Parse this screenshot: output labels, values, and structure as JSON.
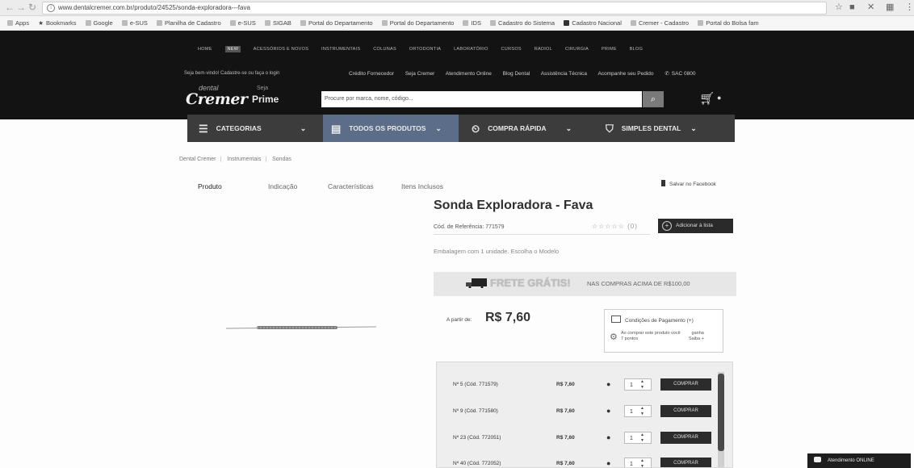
{
  "browser": {
    "url": "www.dentalcremer.com.br/produto/24525/sonda-exploradora---fava",
    "back_icon": "back-arrow-icon",
    "forward_icon": "forward-arrow-icon",
    "reload_icon": "reload-icon",
    "bookmarks": [
      "Apps",
      "Bookmarks",
      "Google",
      "e-SUS",
      "Planilha de Cadastro",
      "e-SUS",
      "SIGAB",
      "Portal do Departamento",
      "Portal do Departamento",
      "IDS",
      "Cadastro do Sistema",
      "Cadastro Nacional",
      "Cremer - Cadastro",
      "Portal do Bolsa fam"
    ]
  },
  "header": {
    "top_links": [
      "HOME",
      "NEW",
      "ACESSÓRIOS E NOVOS",
      "INSTRUMENTAIS",
      "COLUNAS",
      "ORTODONTIA",
      "LABORATÓRIO",
      "CURSOS",
      "RADIOL",
      "CIRURGIA",
      "PRIME",
      "BLOG"
    ],
    "welcome": "Seja bem-vindo! Cadastre-se ou faça o login",
    "links": [
      "Crédito Fornecedor",
      "Seja Cremer",
      "Atendimento Online",
      "Blog Dental",
      "Assistência Técnica",
      "Acompanhe seu Pedido",
      "SAC 0800"
    ],
    "logo_small": "dental",
    "logo": "Cremer",
    "prime_top": "Seja",
    "prime": "Prime",
    "search_placeholder": "Procure por marca, nome, código..."
  },
  "navbar": {
    "categories": "CATEGORIAS",
    "all_products": "TODOS OS PRODUTOS",
    "quick_buy": "COMPRA RÁPIDA",
    "simples": "SIMPLES DENTAL"
  },
  "breadcrumb": [
    "Dental Cremer",
    "Instrumentais",
    "Sondas"
  ],
  "tabs": [
    "Produto",
    "Indicação",
    "Características",
    "Itens Inclusos"
  ],
  "facebook_save": "Salvar no Facebook",
  "product": {
    "title": "Sonda Exploradora - Fava",
    "ref": "Cód. de Referência: 771579",
    "rating_stars": "☆☆☆☆☆",
    "rating_value": 0,
    "rating_count": "(0)",
    "add_list": "Adicionar à lista",
    "description": "Embalagem com 1 unidade. Escolha o Modelo",
    "shipping_big": "FRETE GRÁTIS!",
    "shipping_small": "NAS COMPRAS ACIMA DE R$100,00",
    "from_label": "A partir de:",
    "price": "R$ 7,60",
    "payment": "Condições de Pagamento (+)",
    "points_line1": "Ao comprar este produto você",
    "points_line2": "7 pontos",
    "points_right1": "ganha",
    "points_right2": "Saiba +"
  },
  "variants": [
    {
      "name": "Nº 5 (Cód. 771579)",
      "price": "R$ 7,60",
      "qty": "1",
      "buy": "COMPRAR"
    },
    {
      "name": "Nº 9 (Cód. 771580)",
      "price": "R$ 7,60",
      "qty": "1",
      "buy": "COMPRAR"
    },
    {
      "name": "Nº 23 (Cód. 772051)",
      "price": "R$ 7,60",
      "qty": "1",
      "buy": "COMPRAR"
    },
    {
      "name": "Nº 40 (Cód. 772052)",
      "price": "R$ 7,60",
      "qty": "1",
      "buy": "COMPRAR"
    }
  ],
  "chat": "Atendimento ONLINE",
  "colors": {
    "header": "#131313",
    "navbar": "#3c3c3c",
    "nav_active": "#5b6d88",
    "buy_button": "#2c2c2c"
  }
}
